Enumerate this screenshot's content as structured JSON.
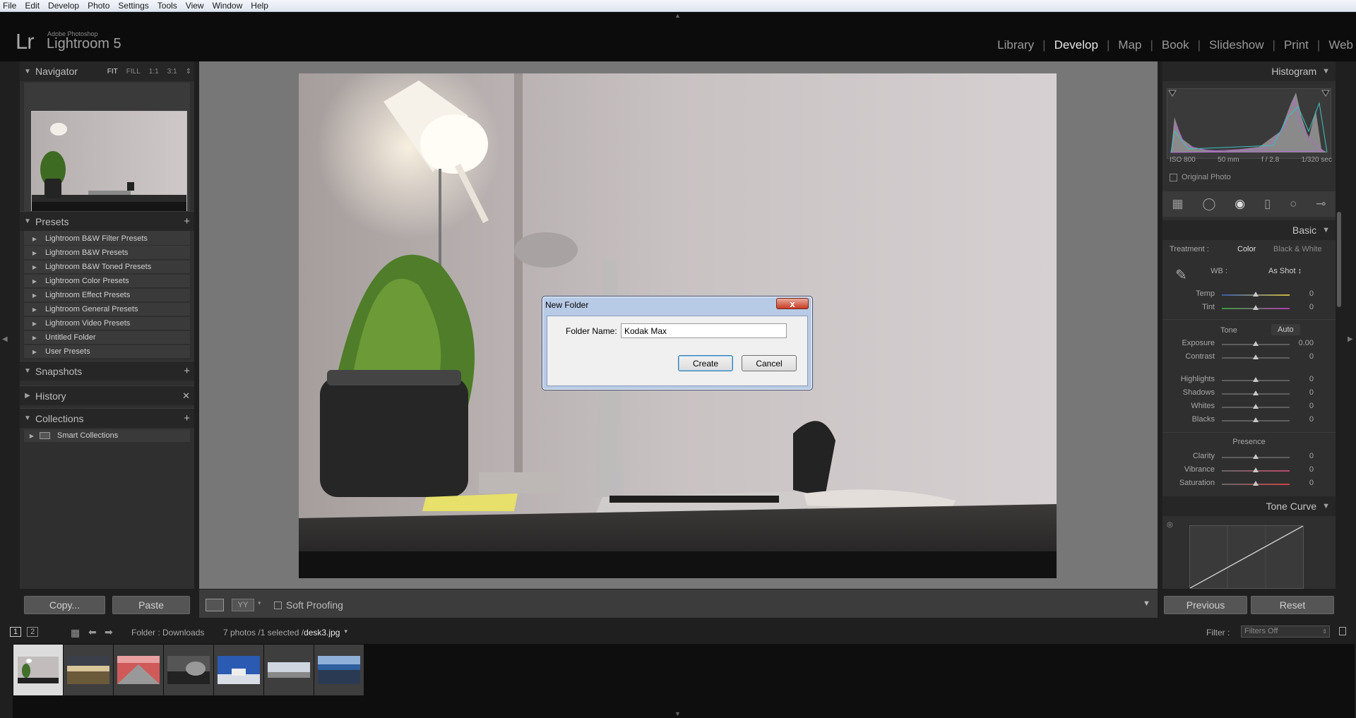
{
  "menubar": [
    "File",
    "Edit",
    "Develop",
    "Photo",
    "Settings",
    "Tools",
    "View",
    "Window",
    "Help"
  ],
  "app": {
    "logo": "Lr",
    "vendor": "Adobe Photoshop",
    "name": "Lightroom 5"
  },
  "modules": [
    {
      "label": "Library",
      "active": false
    },
    {
      "label": "Develop",
      "active": true
    },
    {
      "label": "Map",
      "active": false
    },
    {
      "label": "Book",
      "active": false
    },
    {
      "label": "Slideshow",
      "active": false
    },
    {
      "label": "Print",
      "active": false
    },
    {
      "label": "Web",
      "active": false
    }
  ],
  "left": {
    "navigator": {
      "title": "Navigator",
      "options": [
        "FIT",
        "FILL",
        "1:1",
        "3:1"
      ]
    },
    "presets": {
      "title": "Presets",
      "items": [
        "Lightroom B&W Filter Presets",
        "Lightroom B&W Presets",
        "Lightroom B&W Toned Presets",
        "Lightroom Color Presets",
        "Lightroom Effect Presets",
        "Lightroom General Presets",
        "Lightroom Video Presets",
        "Untitled Folder",
        "User Presets"
      ]
    },
    "snapshots": "Snapshots",
    "history": "History",
    "collections": {
      "title": "Collections",
      "items": [
        "Smart Collections"
      ]
    },
    "copy_label": "Copy...",
    "paste_label": "Paste"
  },
  "toolbar": {
    "soft_proofing": "Soft Proofing"
  },
  "right": {
    "histogram": {
      "title": "Histogram",
      "iso": "ISO 800",
      "focal": "50 mm",
      "aperture": "f / 2.8",
      "shutter": "1/320 sec",
      "original_photo": "Original Photo"
    },
    "basic": {
      "title": "Basic",
      "treatment_label": "Treatment :",
      "treatment_color": "Color",
      "treatment_bw": "Black & White",
      "wb_label": "WB :",
      "wb_value": "As Shot ↕",
      "temp_label": "Temp",
      "temp_value": "0",
      "tint_label": "Tint",
      "tint_value": "0",
      "tone_label": "Tone",
      "auto_label": "Auto",
      "exposure_label": "Exposure",
      "exposure_value": "0.00",
      "contrast_label": "Contrast",
      "contrast_value": "0",
      "highlights_label": "Highlights",
      "highlights_value": "0",
      "shadows_label": "Shadows",
      "shadows_value": "0",
      "whites_label": "Whites",
      "whites_value": "0",
      "blacks_label": "Blacks",
      "blacks_value": "0",
      "presence_label": "Presence",
      "clarity_label": "Clarity",
      "clarity_value": "0",
      "vibrance_label": "Vibrance",
      "vibrance_value": "0",
      "saturation_label": "Saturation",
      "saturation_value": "0"
    },
    "tone_curve": "Tone Curve",
    "previous_label": "Previous",
    "reset_label": "Reset"
  },
  "filmstrip": {
    "page1": "1",
    "page2": "2",
    "folder": "Folder : Downloads",
    "count": "7 photos /1 selected /",
    "filename": "desk3.jpg",
    "filter_label": "Filter :",
    "filter_value": "Filters Off"
  },
  "dialog": {
    "title": "New Folder",
    "close_label": "x",
    "field_label": "Folder Name:",
    "field_value": "Kodak Max",
    "create_label": "Create",
    "cancel_label": "Cancel"
  }
}
